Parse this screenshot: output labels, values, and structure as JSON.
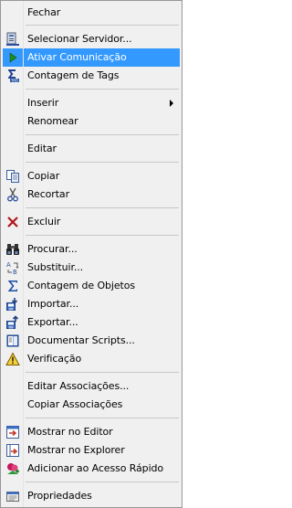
{
  "menu": {
    "items": [
      {
        "label": "Fechar"
      },
      {
        "label": "Selecionar Servidor...",
        "icon": "server-icon"
      },
      {
        "label": "Ativar Comunicação",
        "icon": "play-icon"
      },
      {
        "label": "Contagem de Tags",
        "icon": "tag-count-icon"
      },
      {
        "label": "Inserir"
      },
      {
        "label": "Renomear"
      },
      {
        "label": "Editar"
      },
      {
        "label": "Copiar",
        "icon": "copy-icon"
      },
      {
        "label": "Recortar",
        "icon": "scissors-icon"
      },
      {
        "label": "Excluir",
        "icon": "delete-icon"
      },
      {
        "label": "Procurar...",
        "icon": "binoculars-icon"
      },
      {
        "label": "Substituir...",
        "icon": "replace-icon"
      },
      {
        "label": "Contagem de Objetos",
        "icon": "sigma-icon"
      },
      {
        "label": "Importar...",
        "icon": "import-icon"
      },
      {
        "label": "Exportar...",
        "icon": "export-icon"
      },
      {
        "label": "Documentar Scripts...",
        "icon": "book-icon"
      },
      {
        "label": "Verificação",
        "icon": "warning-icon"
      },
      {
        "label": "Editar Associações..."
      },
      {
        "label": "Copiar Associações"
      },
      {
        "label": "Mostrar no Editor",
        "icon": "show-in-editor-icon"
      },
      {
        "label": "Mostrar no Explorer",
        "icon": "show-in-explorer-icon"
      },
      {
        "label": "Adicionar ao Acesso Rápido",
        "icon": "quick-access-icon"
      },
      {
        "label": "Propriedades",
        "icon": "properties-icon"
      }
    ],
    "highlight_color": "#3399ff"
  }
}
